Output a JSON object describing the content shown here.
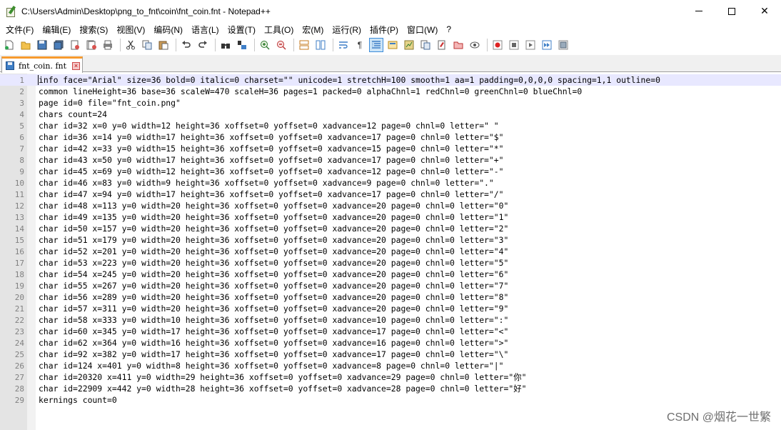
{
  "window": {
    "title": "C:\\Users\\Admin\\Desktop\\png_to_fnt\\coin\\fnt_coin.fnt - Notepad++",
    "close_glyph": "✕"
  },
  "menu": [
    "文件(F)",
    "编辑(E)",
    "搜索(S)",
    "视图(V)",
    "编码(N)",
    "语言(L)",
    "设置(T)",
    "工具(O)",
    "宏(M)",
    "运行(R)",
    "插件(P)",
    "窗口(W)",
    "?"
  ],
  "toolbar": {
    "icons": [
      "new-file-icon",
      "open-file-icon",
      "save-icon",
      "save-all-icon",
      "close-icon",
      "close-all-icon",
      "print-icon",
      "cut-icon",
      "copy-icon",
      "paste-icon",
      "undo-icon",
      "redo-icon",
      "find-icon",
      "replace-icon",
      "zoom-in-icon",
      "zoom-out-icon",
      "sync-vertical-icon",
      "sync-horizontal-icon",
      "word-wrap-icon",
      "show-all-chars-icon",
      "indent-guide-icon",
      "udl-icon",
      "doc-map-icon",
      "function-list-icon",
      "folder-workspace-icon",
      "monitoring-icon",
      "record-macro-icon",
      "stop-record-icon",
      "play-macro-icon",
      "run-macro-multiple-icon",
      "save-macro-icon"
    ],
    "pilcrow": "¶"
  },
  "tab": {
    "label": "fnt_coin. fnt",
    "close_glyph": "×"
  },
  "editor": {
    "current_line": 1,
    "lines": [
      "info face=\"Arial\" size=36 bold=0 italic=0 charset=\"\" unicode=1 stretchH=100 smooth=1 aa=1 padding=0,0,0,0 spacing=1,1 outline=0",
      "common lineHeight=36 base=36 scaleW=470 scaleH=36 pages=1 packed=0 alphaChnl=1 redChnl=0 greenChnl=0 blueChnl=0",
      "page id=0 file=\"fnt_coin.png\"",
      "chars count=24",
      "char id=32 x=0 y=0 width=12 height=36 xoffset=0 yoffset=0 xadvance=12 page=0 chnl=0 letter=\" \"",
      "char id=36 x=14 y=0 width=17 height=36 xoffset=0 yoffset=0 xadvance=17 page=0 chnl=0 letter=\"$\"",
      "char id=42 x=33 y=0 width=15 height=36 xoffset=0 yoffset=0 xadvance=15 page=0 chnl=0 letter=\"*\"",
      "char id=43 x=50 y=0 width=17 height=36 xoffset=0 yoffset=0 xadvance=17 page=0 chnl=0 letter=\"+\"",
      "char id=45 x=69 y=0 width=12 height=36 xoffset=0 yoffset=0 xadvance=12 page=0 chnl=0 letter=\"-\"",
      "char id=46 x=83 y=0 width=9 height=36 xoffset=0 yoffset=0 xadvance=9 page=0 chnl=0 letter=\".\"",
      "char id=47 x=94 y=0 width=17 height=36 xoffset=0 yoffset=0 xadvance=17 page=0 chnl=0 letter=\"/\"",
      "char id=48 x=113 y=0 width=20 height=36 xoffset=0 yoffset=0 xadvance=20 page=0 chnl=0 letter=\"0\"",
      "char id=49 x=135 y=0 width=20 height=36 xoffset=0 yoffset=0 xadvance=20 page=0 chnl=0 letter=\"1\"",
      "char id=50 x=157 y=0 width=20 height=36 xoffset=0 yoffset=0 xadvance=20 page=0 chnl=0 letter=\"2\"",
      "char id=51 x=179 y=0 width=20 height=36 xoffset=0 yoffset=0 xadvance=20 page=0 chnl=0 letter=\"3\"",
      "char id=52 x=201 y=0 width=20 height=36 xoffset=0 yoffset=0 xadvance=20 page=0 chnl=0 letter=\"4\"",
      "char id=53 x=223 y=0 width=20 height=36 xoffset=0 yoffset=0 xadvance=20 page=0 chnl=0 letter=\"5\"",
      "char id=54 x=245 y=0 width=20 height=36 xoffset=0 yoffset=0 xadvance=20 page=0 chnl=0 letter=\"6\"",
      "char id=55 x=267 y=0 width=20 height=36 xoffset=0 yoffset=0 xadvance=20 page=0 chnl=0 letter=\"7\"",
      "char id=56 x=289 y=0 width=20 height=36 xoffset=0 yoffset=0 xadvance=20 page=0 chnl=0 letter=\"8\"",
      "char id=57 x=311 y=0 width=20 height=36 xoffset=0 yoffset=0 xadvance=20 page=0 chnl=0 letter=\"9\"",
      "char id=58 x=333 y=0 width=10 height=36 xoffset=0 yoffset=0 xadvance=10 page=0 chnl=0 letter=\":\"",
      "char id=60 x=345 y=0 width=17 height=36 xoffset=0 yoffset=0 xadvance=17 page=0 chnl=0 letter=\"<\"",
      "char id=62 x=364 y=0 width=16 height=36 xoffset=0 yoffset=0 xadvance=16 page=0 chnl=0 letter=\">\"",
      "char id=92 x=382 y=0 width=17 height=36 xoffset=0 yoffset=0 xadvance=17 page=0 chnl=0 letter=\"\\\"",
      "char id=124 x=401 y=0 width=8 height=36 xoffset=0 yoffset=0 xadvance=8 page=0 chnl=0 letter=\"|\"",
      "char id=20320 x=411 y=0 width=29 height=36 xoffset=0 yoffset=0 xadvance=29 page=0 chnl=0 letter=\"你\"",
      "char id=22909 x=442 y=0 width=28 height=36 xoffset=0 yoffset=0 xadvance=28 page=0 chnl=0 letter=\"好\"",
      "kernings count=0"
    ]
  },
  "watermark": "CSDN @烟花一世繁",
  "colors": {
    "tab_accent": "#f79a2e",
    "current_line": "#e8e8ff",
    "gutter": "#e4e4e4",
    "line_number": "#808080"
  }
}
